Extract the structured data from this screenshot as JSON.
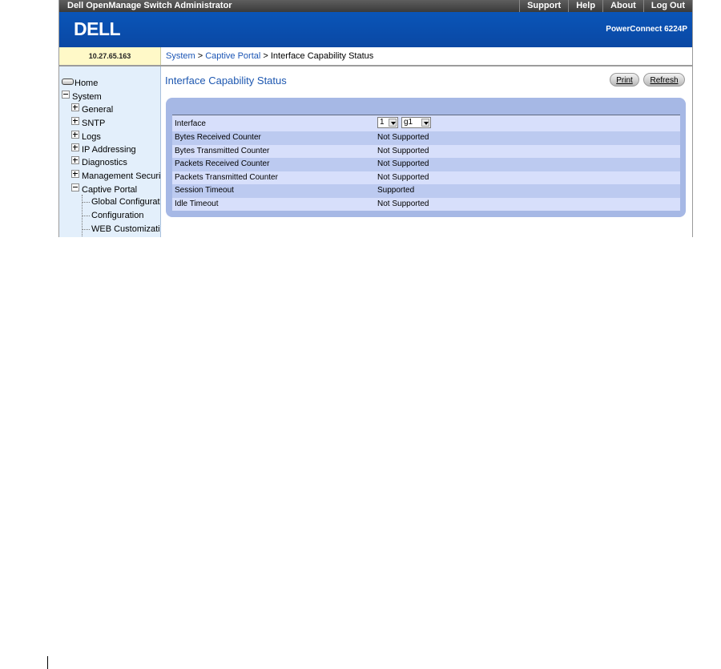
{
  "header": {
    "app_title": "Dell OpenManage Switch Administrator",
    "nav": [
      "Support",
      "Help",
      "About",
      "Log Out"
    ],
    "logo": "DELL",
    "model": "PowerConnect 6224P"
  },
  "ip_address": "10.27.65.163",
  "breadcrumb": {
    "items": [
      "System",
      "Captive Portal"
    ],
    "separator": " > ",
    "current": "Interface Capability Status"
  },
  "sidebar": {
    "items": [
      {
        "label": "Home"
      },
      {
        "label": "System"
      },
      {
        "label": "General"
      },
      {
        "label": "SNTP"
      },
      {
        "label": "Logs"
      },
      {
        "label": "IP Addressing"
      },
      {
        "label": "Diagnostics"
      },
      {
        "label": "Management Security"
      },
      {
        "label": "Captive Portal"
      },
      {
        "label": "Global Configuration"
      },
      {
        "label": "Configuration"
      },
      {
        "label": "WEB Customization"
      }
    ]
  },
  "page": {
    "title": "Interface Capability Status",
    "print_label": "Print",
    "refresh_label": "Refresh"
  },
  "form": {
    "interface_label": "Interface",
    "unit_value": "1",
    "port_value": "g1",
    "rows": [
      {
        "label": "Bytes Received Counter",
        "value": "Not Supported"
      },
      {
        "label": "Bytes Transmitted Counter",
        "value": "Not Supported"
      },
      {
        "label": "Packets Received Counter",
        "value": "Not Supported"
      },
      {
        "label": "Packets Transmitted Counter",
        "value": "Not Supported"
      },
      {
        "label": "Session Timeout",
        "value": "Supported"
      },
      {
        "label": "Idle Timeout",
        "value": "Not Supported"
      }
    ]
  },
  "colors": {
    "brand_blue": "#0a4fae",
    "title_blue": "#1d57b0",
    "panel_blue": "#a6b8e5",
    "ip_yellow": "#fff9c8"
  }
}
